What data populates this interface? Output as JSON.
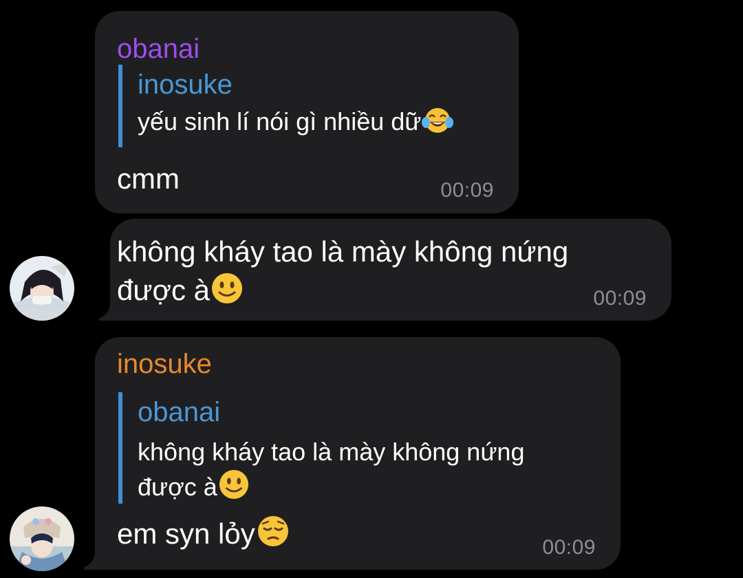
{
  "colors": {
    "background": "#000000",
    "bubble": "#1f1f21",
    "sender_obanai": "#9a4ff0",
    "sender_inosuke": "#e8892a",
    "quote_bar": "#3f8fd2",
    "quote_author": "#4a97d6",
    "timestamp": "#8e8e93"
  },
  "messages": [
    {
      "sender": "obanai",
      "reply": {
        "author": "inosuke",
        "text": "yếu sinh lí nói gì nhiều dữ",
        "emoji": "face-with-tears-of-joy"
      },
      "text": "cmm",
      "time": "00:09"
    },
    {
      "text_line1": "không kháy tao là mày không nứng",
      "text_line2": "được à",
      "emoji": "slightly-smiling-face",
      "time": "00:09",
      "avatar": "obanai-avatar"
    },
    {
      "sender": "inosuke",
      "reply": {
        "author": "obanai",
        "text_line1": "không kháy tao là mày không nứng",
        "text_line2": "được à",
        "emoji": "slightly-smiling-face"
      },
      "text": "em syn lỏy",
      "emoji": "pensive-face",
      "time": "00:09",
      "avatar": "inosuke-avatar"
    }
  ]
}
